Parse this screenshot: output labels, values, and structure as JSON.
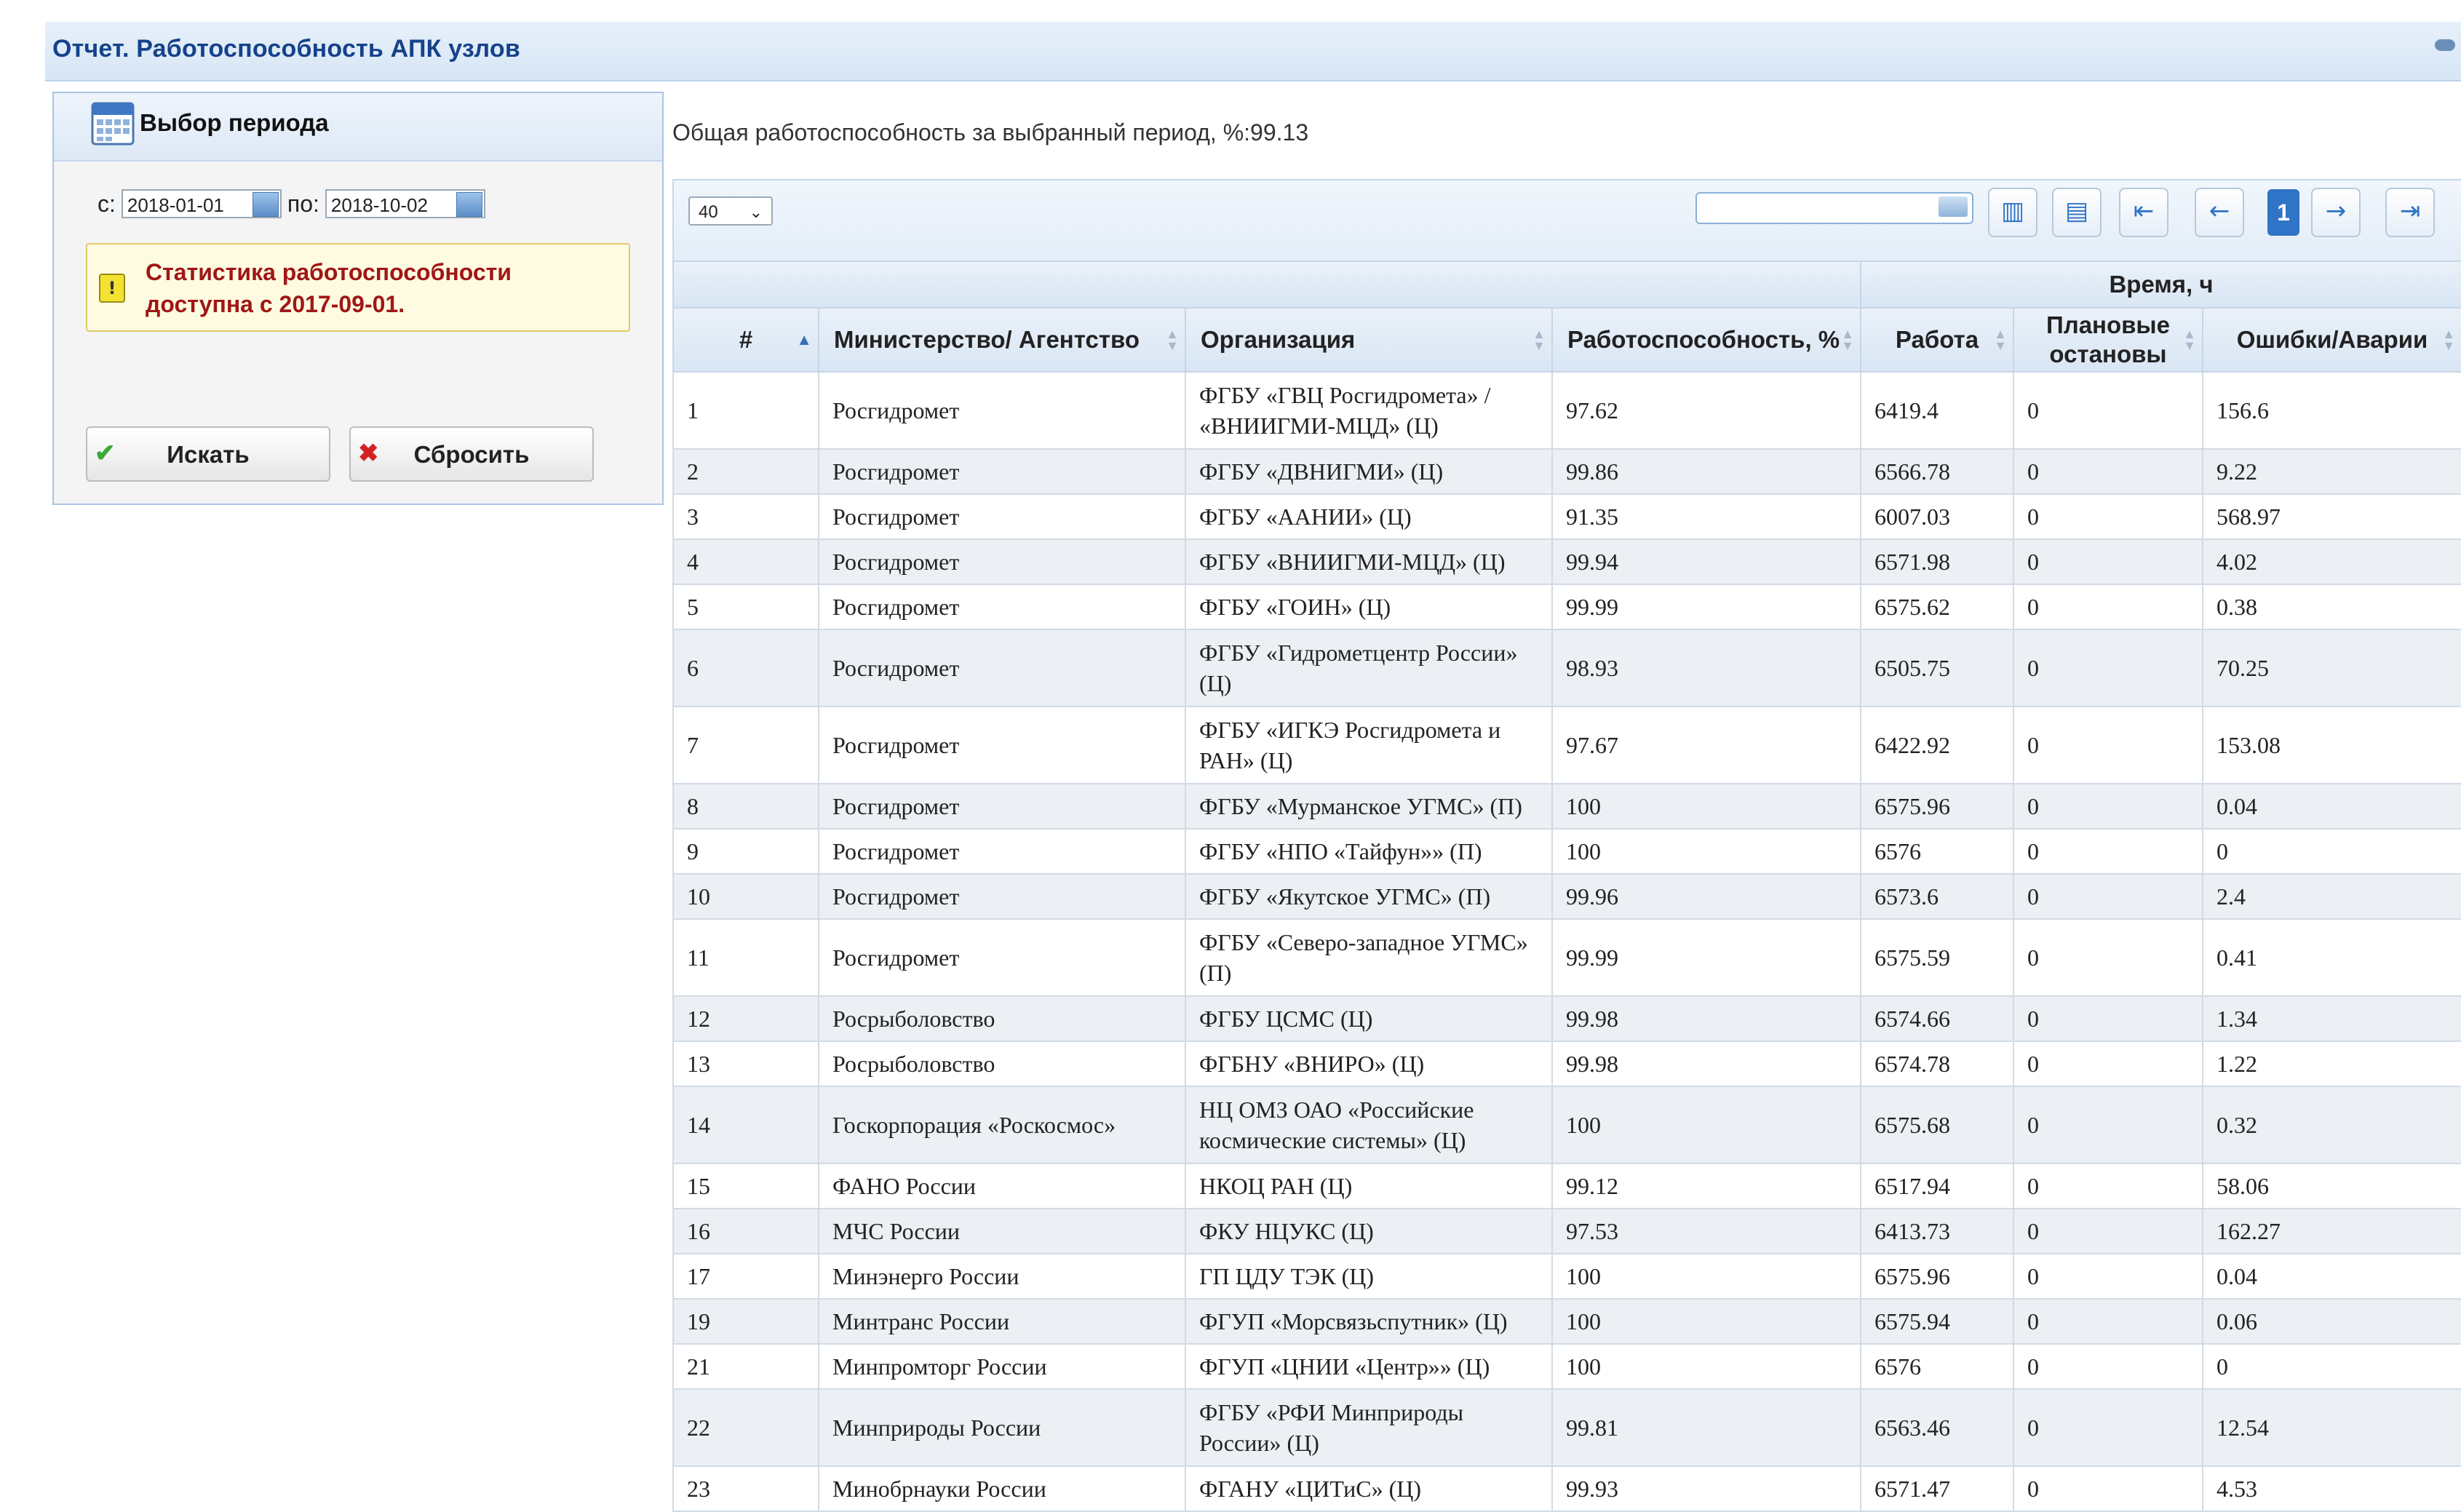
{
  "window": {
    "title": "Отчет. Работоспособность АПК узлов"
  },
  "filter": {
    "title": "Выбор периода",
    "from_label": "с:",
    "from_value": "2018-01-01",
    "to_label": "по:",
    "to_value": "2018-10-02",
    "warning": "Статистика работоспособности доступна с 2017-09-01.",
    "search_button": "Искать",
    "reset_button": "Сбросить"
  },
  "summary": "Общая работоспособность за выбранный период, %:99.13",
  "toolbar": {
    "page_size": "40",
    "search_placeholder": "",
    "current_page": "1"
  },
  "table": {
    "group_header": "Время, ч",
    "columns": [
      "#",
      "Министерство/ Агентство",
      "Организация",
      "Работоспособность, %",
      "Работа",
      "Плановые остановы",
      "Ошибки/Аварии"
    ],
    "rows": [
      {
        "n": "1",
        "ministry": "Росгидромет",
        "org": "ФГБУ «ГВЦ Росгидромета» / «ВНИИГМИ-МЦД» (Ц)",
        "perf": "97.62",
        "work": "6419.4",
        "planned": "0",
        "errors": "156.6"
      },
      {
        "n": "2",
        "ministry": "Росгидромет",
        "org": "ФГБУ «ДВНИГМИ» (Ц)",
        "perf": "99.86",
        "work": "6566.78",
        "planned": "0",
        "errors": "9.22"
      },
      {
        "n": "3",
        "ministry": "Росгидромет",
        "org": "ФГБУ «ААНИИ» (Ц)",
        "perf": "91.35",
        "work": "6007.03",
        "planned": "0",
        "errors": "568.97"
      },
      {
        "n": "4",
        "ministry": "Росгидромет",
        "org": "ФГБУ «ВНИИГМИ-МЦД» (Ц)",
        "perf": "99.94",
        "work": "6571.98",
        "planned": "0",
        "errors": "4.02"
      },
      {
        "n": "5",
        "ministry": "Росгидромет",
        "org": "ФГБУ «ГОИН» (Ц)",
        "perf": "99.99",
        "work": "6575.62",
        "planned": "0",
        "errors": "0.38"
      },
      {
        "n": "6",
        "ministry": "Росгидромет",
        "org": "ФГБУ «Гидрометцентр России» (Ц)",
        "perf": "98.93",
        "work": "6505.75",
        "planned": "0",
        "errors": "70.25"
      },
      {
        "n": "7",
        "ministry": "Росгидромет",
        "org": "ФГБУ «ИГКЭ Росгидромета и РАН» (Ц)",
        "perf": "97.67",
        "work": "6422.92",
        "planned": "0",
        "errors": "153.08"
      },
      {
        "n": "8",
        "ministry": "Росгидромет",
        "org": "ФГБУ «Мурманское УГМС» (П)",
        "perf": "100",
        "work": "6575.96",
        "planned": "0",
        "errors": "0.04"
      },
      {
        "n": "9",
        "ministry": "Росгидромет",
        "org": "ФГБУ «НПО «Тайфун»» (П)",
        "perf": "100",
        "work": "6576",
        "planned": "0",
        "errors": "0"
      },
      {
        "n": "10",
        "ministry": "Росгидромет",
        "org": "ФГБУ «Якутское УГМС» (П)",
        "perf": "99.96",
        "work": "6573.6",
        "planned": "0",
        "errors": "2.4"
      },
      {
        "n": "11",
        "ministry": "Росгидромет",
        "org": "ФГБУ «Северо-западное УГМС» (П)",
        "perf": "99.99",
        "work": "6575.59",
        "planned": "0",
        "errors": "0.41"
      },
      {
        "n": "12",
        "ministry": "Росрыболовство",
        "org": "ФГБУ ЦСМС (Ц)",
        "perf": "99.98",
        "work": "6574.66",
        "planned": "0",
        "errors": "1.34"
      },
      {
        "n": "13",
        "ministry": "Росрыболовство",
        "org": "ФГБНУ «ВНИРО» (Ц)",
        "perf": "99.98",
        "work": "6574.78",
        "planned": "0",
        "errors": "1.22"
      },
      {
        "n": "14",
        "ministry": "Госкорпорация «Роскосмос»",
        "org": "НЦ ОМЗ ОАО «Российские космические системы» (Ц)",
        "perf": "100",
        "work": "6575.68",
        "planned": "0",
        "errors": "0.32"
      },
      {
        "n": "15",
        "ministry": "ФАНО России",
        "org": "НКОЦ РАН (Ц)",
        "perf": "99.12",
        "work": "6517.94",
        "planned": "0",
        "errors": "58.06"
      },
      {
        "n": "16",
        "ministry": "МЧС России",
        "org": "ФКУ НЦУКС (Ц)",
        "perf": "97.53",
        "work": "6413.73",
        "planned": "0",
        "errors": "162.27"
      },
      {
        "n": "17",
        "ministry": "Минэнерго России",
        "org": "ГП ЦДУ ТЭК (Ц)",
        "perf": "100",
        "work": "6575.96",
        "planned": "0",
        "errors": "0.04"
      },
      {
        "n": "19",
        "ministry": "Минтранс России",
        "org": "ФГУП «Морсвязьспутник» (Ц)",
        "perf": "100",
        "work": "6575.94",
        "planned": "0",
        "errors": "0.06"
      },
      {
        "n": "21",
        "ministry": "Минпромторг России",
        "org": "ФГУП «ЦНИИ «Центр»» (Ц)",
        "perf": "100",
        "work": "6576",
        "planned": "0",
        "errors": "0"
      },
      {
        "n": "22",
        "ministry": "Минприроды России",
        "org": "ФГБУ «РФИ Минприроды России» (Ц)",
        "perf": "99.81",
        "work": "6563.46",
        "planned": "0",
        "errors": "12.54"
      },
      {
        "n": "23",
        "ministry": "Минобрнауки России",
        "org": "ФГАНУ «ЦИТиС» (Ц)",
        "perf": "99.93",
        "work": "6571.47",
        "planned": "0",
        "errors": "4.53"
      }
    ]
  }
}
